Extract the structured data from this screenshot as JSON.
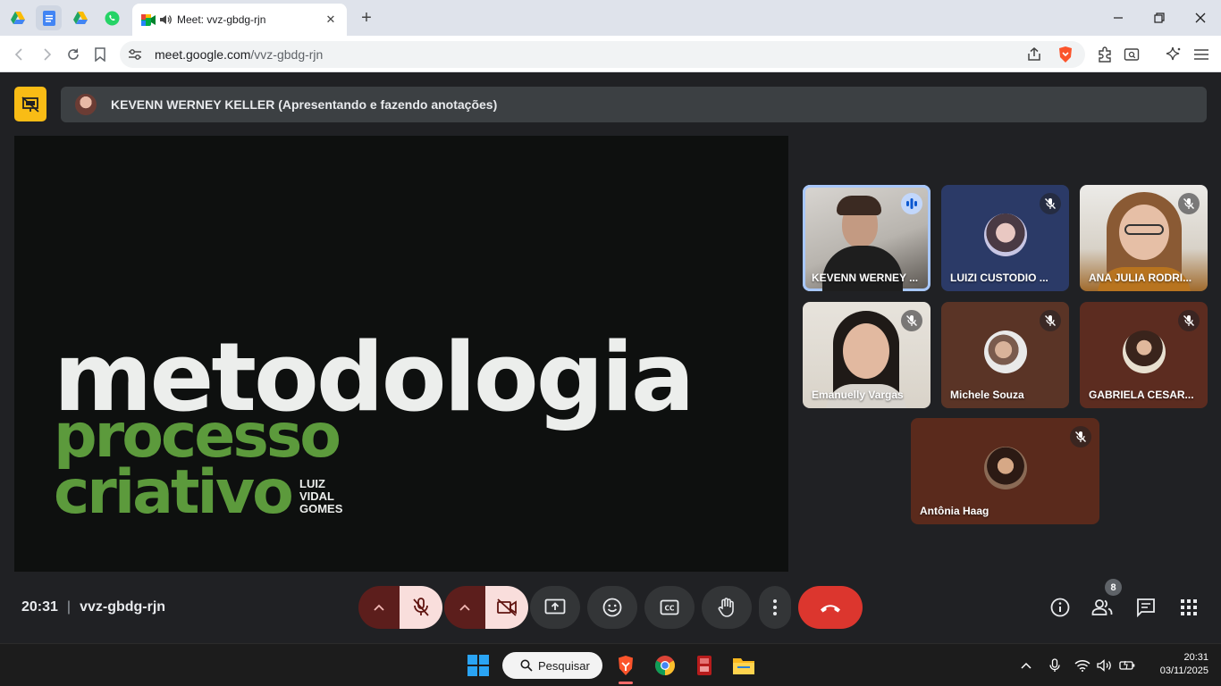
{
  "browser": {
    "tab_title": "Meet: vvz-gbdg-rjn",
    "url": "meet.google.com/vvz-gbdg-rjn",
    "url_host": "meet.google.com",
    "url_path": "/vvz-gbdg-rjn",
    "pinned_tabs": [
      "google-drive-icon",
      "google-docs-icon",
      "google-drive-icon",
      "whatsapp-icon"
    ]
  },
  "meet": {
    "presenter_banner": "KEVENN WERNEY KELLER (Apresentando e fazendo anotações)",
    "slide": {
      "line1": "metodologia",
      "line2": "processo",
      "line3": "criativo",
      "author_1": "LUIZ",
      "author_2": "VIDAL",
      "author_3": "GOMES"
    },
    "participants": [
      {
        "name": "KEVENN WERNEY ...",
        "state": "speaking"
      },
      {
        "name": "LUIZI CUSTODIO ...",
        "state": "muted"
      },
      {
        "name": "ANA JULIA RODRI...",
        "state": "muted"
      },
      {
        "name": "Emanuelly Vargas",
        "state": "muted"
      },
      {
        "name": "Michele Souza",
        "state": "muted"
      },
      {
        "name": "GABRIELA CESAR...",
        "state": "muted"
      },
      {
        "name": "Antônia Haag",
        "state": "muted"
      }
    ],
    "time": "20:31",
    "meeting_code": "vvz-gbdg-rjn",
    "participant_count": "8",
    "colors": {
      "accent_yellow": "#f9bc15",
      "hangup_red": "#dc362e",
      "muted_bg": "#f9dedc",
      "speaking_outline": "#a8c7fa"
    }
  },
  "taskbar": {
    "search_label": "Pesquisar",
    "time": "20:31",
    "date": "03/11/2025"
  }
}
